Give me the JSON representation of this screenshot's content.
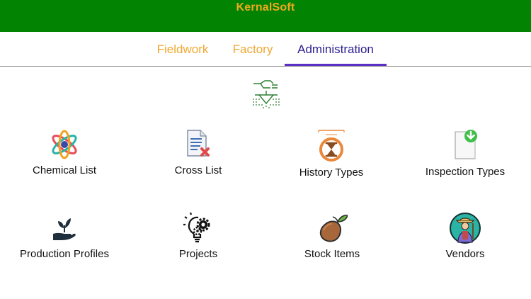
{
  "app": {
    "title": "KernalSoft"
  },
  "colors": {
    "header_bg": "#028302",
    "title": "#f1a81d",
    "tab_inactive": "#f0a830",
    "tab_active": "#2a1f8f",
    "tab_indicator": "#5b2fc6"
  },
  "tabs": [
    {
      "label": "Fieldwork",
      "active": false
    },
    {
      "label": "Factory",
      "active": false
    },
    {
      "label": "Administration",
      "active": true
    }
  ],
  "header_icon": "field-inspection-icon",
  "tiles": [
    {
      "label": "Chemical List",
      "icon": "atom-icon"
    },
    {
      "label": "Cross List",
      "icon": "document-cross-icon"
    },
    {
      "label": "History Types",
      "icon": "hourglass-icon"
    },
    {
      "label": "Inspection Types",
      "icon": "document-check-icon"
    },
    {
      "label": "Production Profiles",
      "icon": "hand-plant-icon"
    },
    {
      "label": "Projects",
      "icon": "lightbulb-gear-icon"
    },
    {
      "label": "Stock Items",
      "icon": "potato-icon"
    },
    {
      "label": "Vendors",
      "icon": "farmer-icon"
    }
  ]
}
